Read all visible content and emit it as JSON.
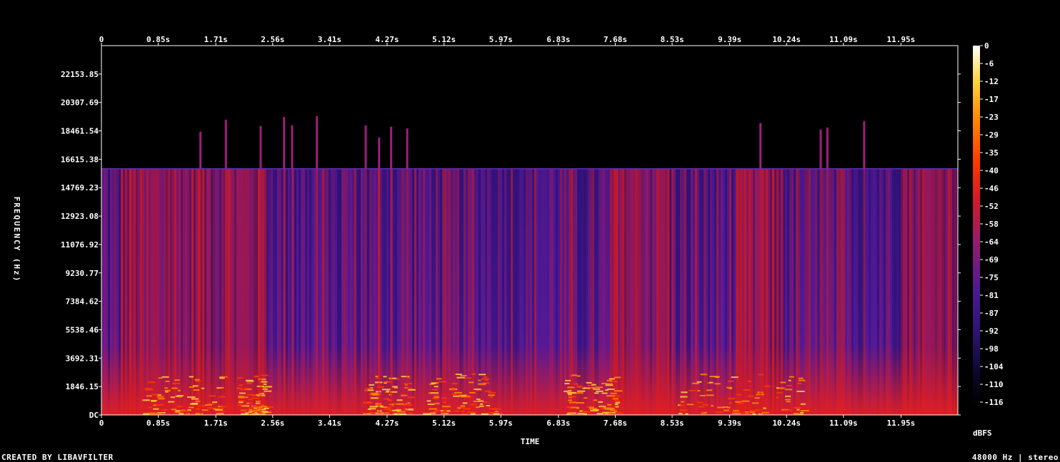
{
  "chart_data": {
    "type": "heatmap",
    "title": "",
    "xlabel": "TIME",
    "ylabel": "FREQUENCY (Hz)",
    "x_ticks": [
      "0",
      "0.85s",
      "1.71s",
      "2.56s",
      "3.41s",
      "4.27s",
      "5.12s",
      "5.97s",
      "6.83s",
      "7.68s",
      "8.53s",
      "9.39s",
      "10.24s",
      "11.09s",
      "11.95s"
    ],
    "x_tick_values": [
      0,
      0.85,
      1.71,
      2.56,
      3.41,
      4.27,
      5.12,
      5.97,
      6.83,
      7.68,
      8.53,
      9.39,
      10.24,
      11.09,
      11.95
    ],
    "xlim": [
      0,
      12.8
    ],
    "y_ticks": [
      "DC",
      "1846.15",
      "3692.31",
      "5538.46",
      "7384.62",
      "9230.77",
      "11076.92",
      "12923.08",
      "14769.23",
      "16615.38",
      "18461.54",
      "20307.69",
      "22153.85"
    ],
    "y_tick_values": [
      0,
      1846.15,
      3692.31,
      5538.46,
      7384.62,
      9230.77,
      11076.92,
      12923.08,
      14769.23,
      16615.38,
      18461.54,
      20307.69,
      22153.85
    ],
    "ylim": [
      0,
      24000
    ],
    "colorbar": {
      "label": "dBFS",
      "ticks": [
        "0",
        "-6",
        "-12",
        "-17",
        "-23",
        "-29",
        "-35",
        "-40",
        "-46",
        "-52",
        "-58",
        "-64",
        "-69",
        "-75",
        "-81",
        "-87",
        "-92",
        "-98",
        "-104",
        "-110",
        "-116"
      ],
      "range": [
        -120,
        0
      ]
    },
    "cutoff_frequency_hz": 16000,
    "high_energy_time_ranges_s": [
      [
        0.3,
        2.5
      ],
      [
        7.6,
        8.5
      ],
      [
        9.5,
        10.2
      ],
      [
        11.95,
        12.8
      ]
    ],
    "transient_times_s": [
      1.48,
      1.86,
      2.38,
      2.73,
      2.85,
      3.22,
      3.95,
      4.15,
      4.33,
      4.57,
      9.85,
      10.75,
      10.85,
      11.4
    ]
  },
  "footer": {
    "credit": "CREATED BY LIBAVFILTER",
    "info": "48000 Hz | stereo"
  }
}
